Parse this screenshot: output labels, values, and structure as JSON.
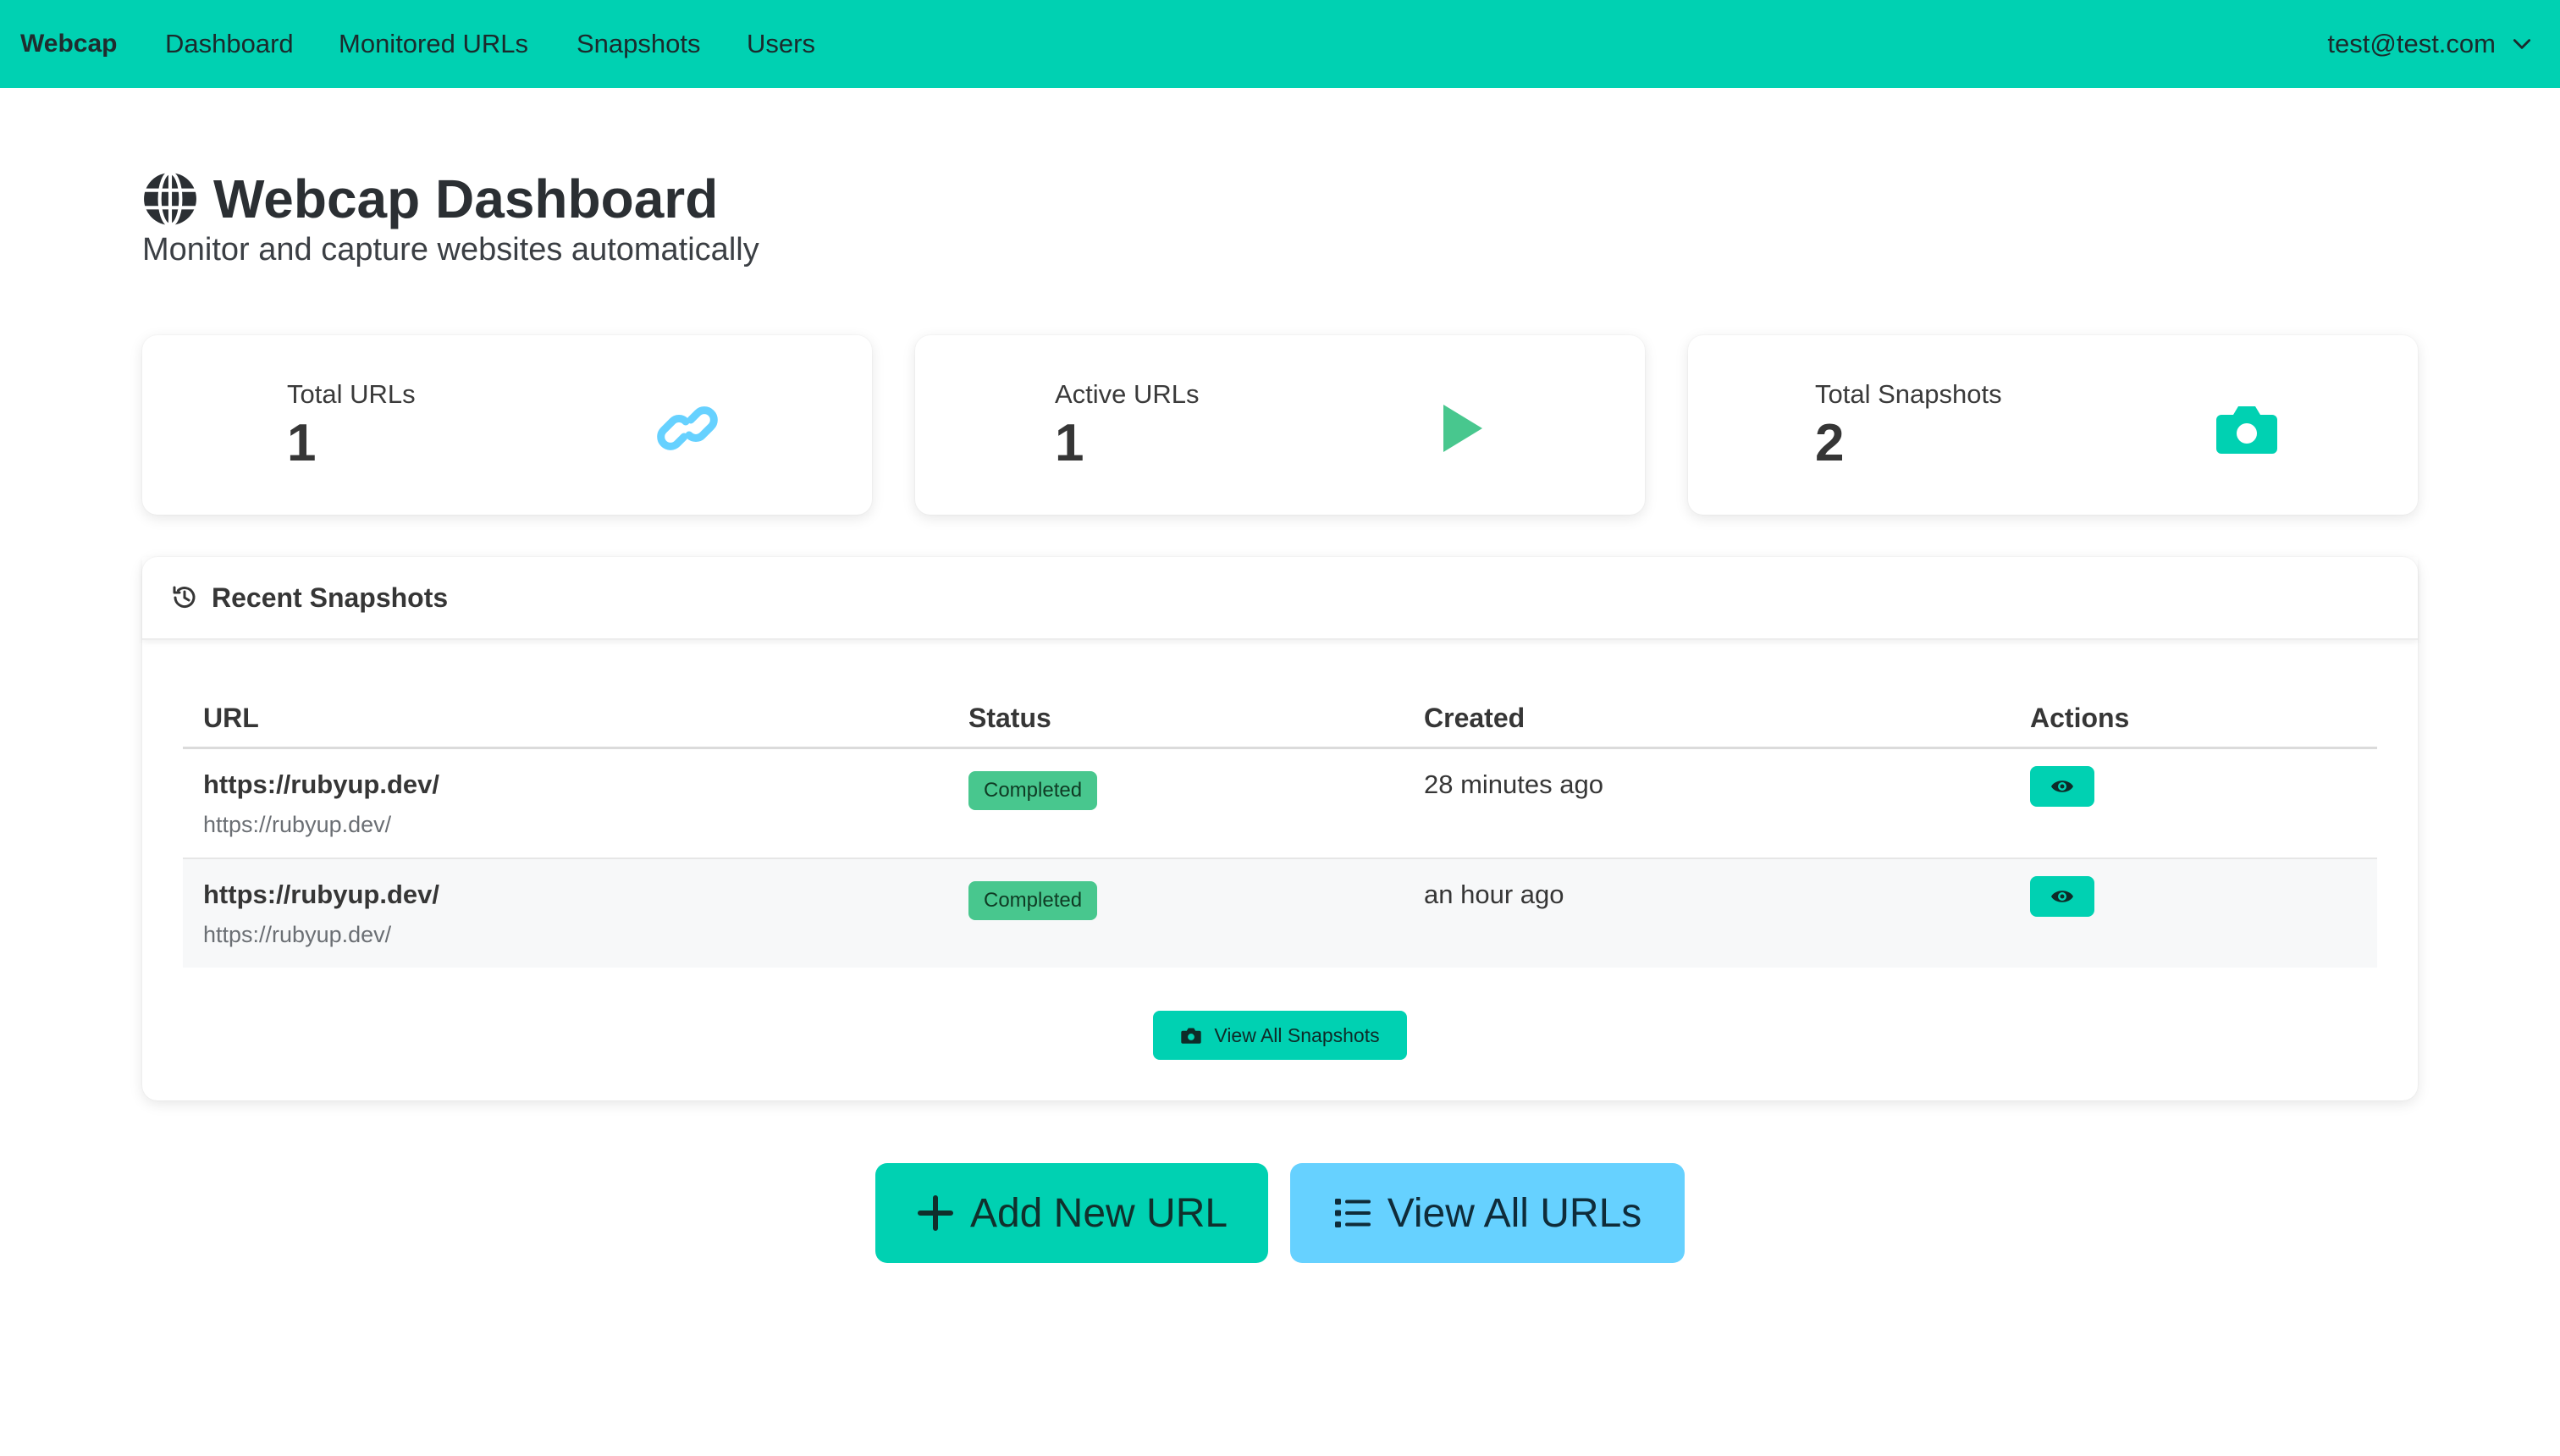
{
  "navbar": {
    "brand": "Webcap",
    "links": [
      "Dashboard",
      "Monitored URLs",
      "Snapshots",
      "Users"
    ],
    "user": "test@test.com"
  },
  "header": {
    "title": "Webcap Dashboard",
    "subtitle": "Monitor and capture websites automatically"
  },
  "stats": [
    {
      "label": "Total URLs",
      "value": "1",
      "icon": "link-icon",
      "color": "#3e8ed0"
    },
    {
      "label": "Active URLs",
      "value": "1",
      "icon": "play-icon",
      "color": "#48c78e"
    },
    {
      "label": "Total Snapshots",
      "value": "2",
      "icon": "camera-icon",
      "color": "#00d1b2"
    }
  ],
  "recent": {
    "title": "Recent Snapshots",
    "columns": [
      "URL",
      "Status",
      "Created",
      "Actions"
    ],
    "rows": [
      {
        "url": "https://rubyup.dev/",
        "url_sub": "https://rubyup.dev/",
        "status": "Completed",
        "created": "28 minutes ago"
      },
      {
        "url": "https://rubyup.dev/",
        "url_sub": "https://rubyup.dev/",
        "status": "Completed",
        "created": "an hour ago"
      }
    ],
    "view_all_label": "View All Snapshots"
  },
  "actions": {
    "add_url": "Add New URL",
    "view_urls": "View All URLs"
  },
  "colors": {
    "primary": "#00d1b2",
    "success": "#48c78e",
    "info": "#66d1ff",
    "link": "#3e8ed0"
  }
}
